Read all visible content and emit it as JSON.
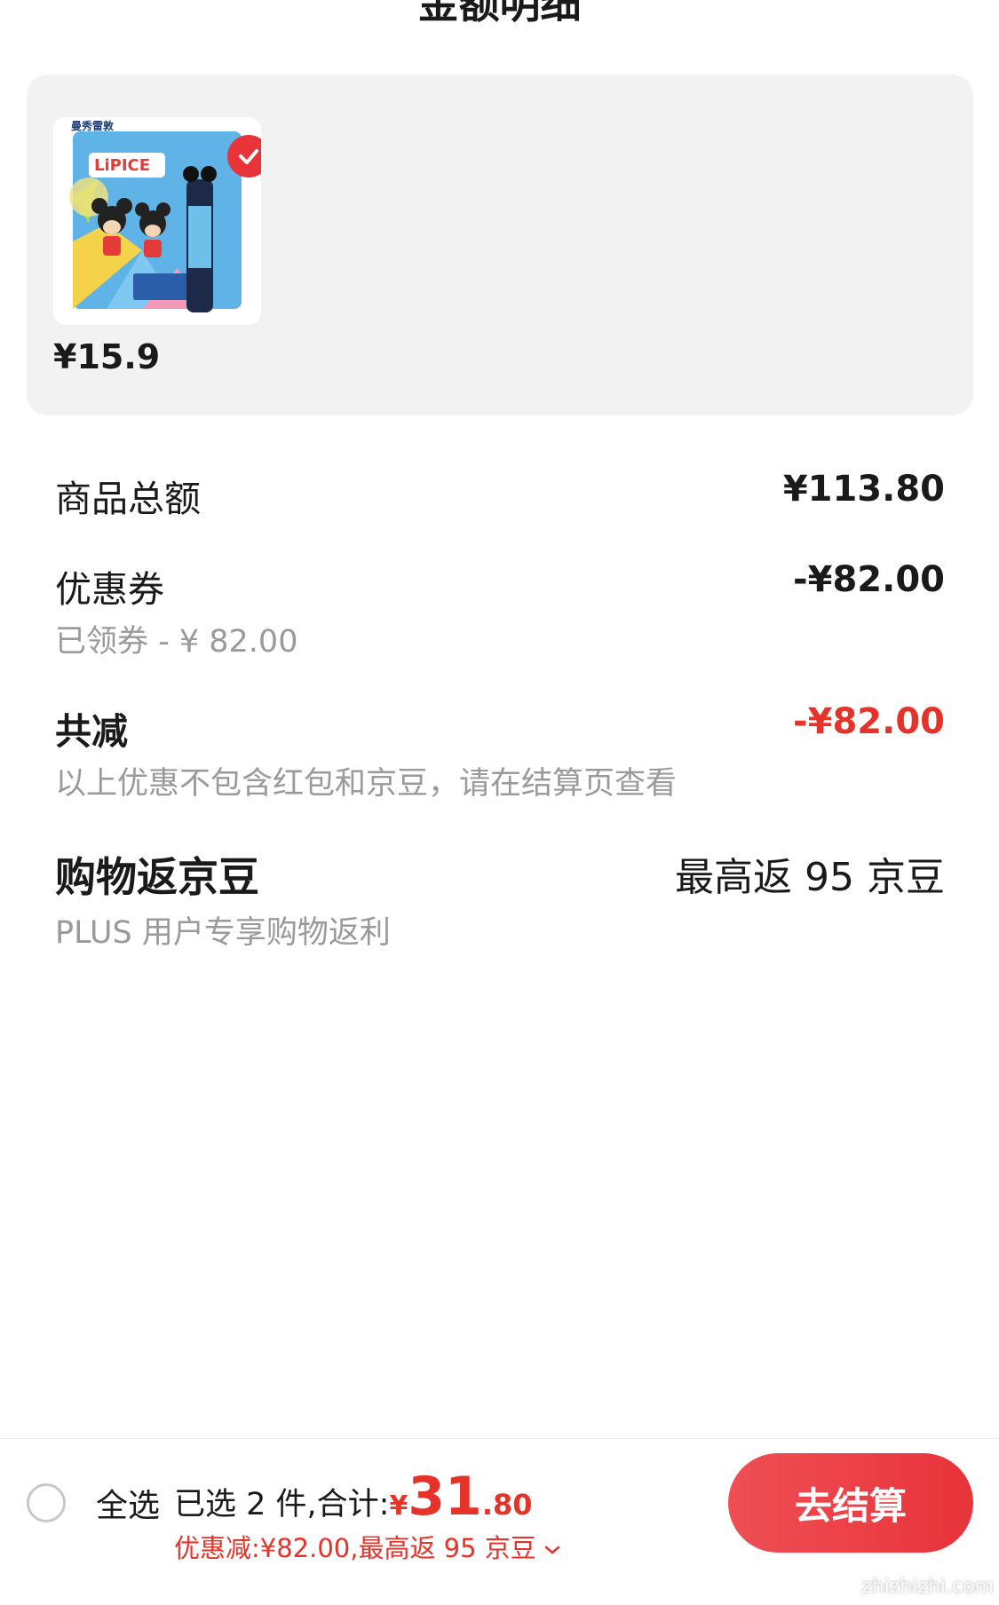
{
  "header": {
    "title": "金额明细"
  },
  "product": {
    "price": "¥15.9",
    "selected": true,
    "image": {
      "brand_text": "曼秀雷敦",
      "logo_text": "LiPICE",
      "icon": "lip-balm-product-image"
    }
  },
  "rows": {
    "total": {
      "label": "商品总额",
      "value": "¥113.80"
    },
    "coupon": {
      "label": "优惠券",
      "value": "-¥82.00",
      "sub": "已领券 - ¥ 82.00"
    },
    "reduction": {
      "label": "共减",
      "value": "-¥82.00",
      "sub": "以上优惠不包含红包和京豆，请在结算页查看"
    },
    "beans": {
      "label": "购物返京豆",
      "value": "最高返 95 京豆",
      "sub": "PLUS 用户专享购物返利"
    }
  },
  "bottom_bar": {
    "select_all": "全选",
    "selected_prefix": "已选 2 件,合计:",
    "currency": "¥",
    "amount_int": "31",
    "amount_dec": ".80",
    "discount": "优惠减:¥82.00,最高返 95 京豆",
    "checkout": "去结算"
  },
  "watermark": "zhizhizhi.com",
  "colors": {
    "accent": "#e8333a",
    "muted": "#9a9a9a",
    "card_bg": "#f2f2f2"
  }
}
